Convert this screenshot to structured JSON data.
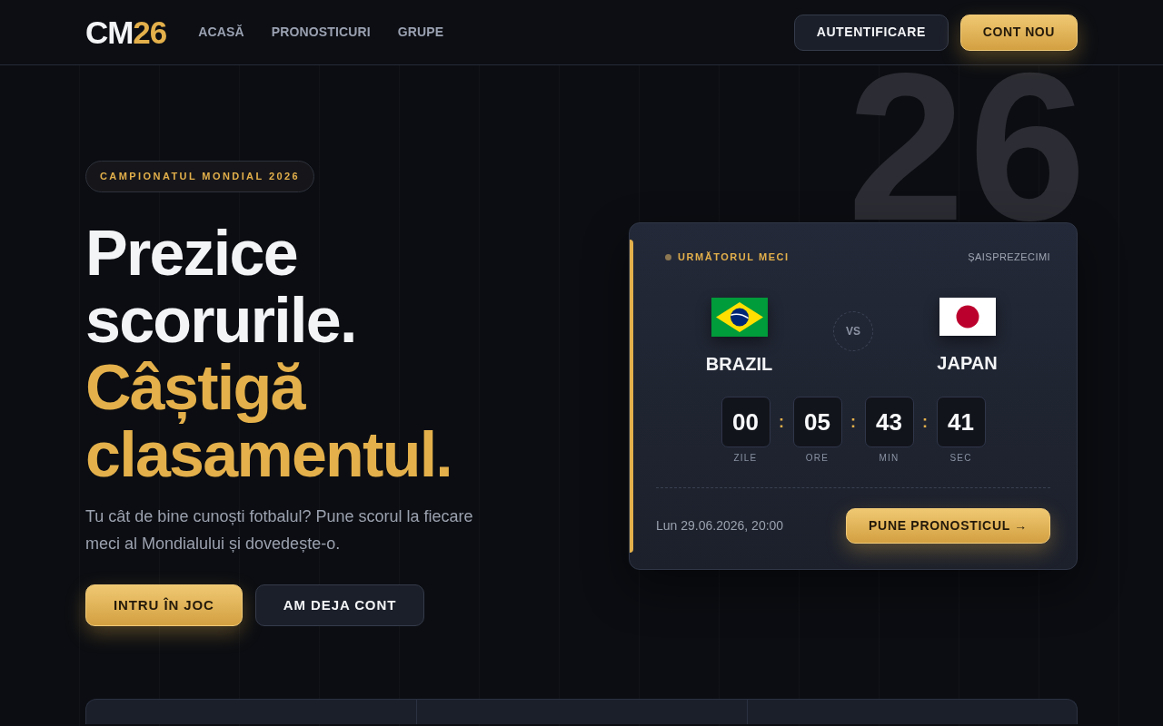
{
  "header": {
    "logo": {
      "text": "CM",
      "accent": "26"
    },
    "nav": [
      "ACASĂ",
      "PRONOSTICURI",
      "GRUPE"
    ],
    "buttons": [
      {
        "label": "AUTENTIFICARE",
        "kind": "secondary"
      },
      {
        "label": "CONT NOU",
        "kind": "primary"
      }
    ]
  },
  "hero": {
    "backdrop_text": "26",
    "badge": "CAMPIONATUL MONDIAL 2026",
    "headline": [
      {
        "text": "Prezice scorurile.",
        "kind": "plain"
      },
      {
        "text": "Câștigă clasamentul.",
        "kind": "accent"
      }
    ],
    "intro": "Tu cât de bine cunoști fotbalul? Pune scorul la fiecare meci al Mondialului și dovedește-o.",
    "buttons": [
      {
        "label": "INTRU ÎN JOC",
        "kind": "primary"
      },
      {
        "label": "AM DEJA CONT",
        "kind": "secondary"
      }
    ]
  },
  "match_card": {
    "label": "URMĂTORUL MECI",
    "stage": "ȘAISPREZECIMI",
    "teams": [
      {
        "name": "BRAZIL",
        "kind": "brazil"
      },
      {
        "name": "JAPAN",
        "kind": "japan"
      }
    ],
    "versus": "VS",
    "countdown": [
      {
        "value": "00",
        "unit": "ZILE"
      },
      {
        "value": "05",
        "unit": "ORE"
      },
      {
        "value": "43",
        "unit": "MIN"
      },
      {
        "value": "41",
        "unit": "SEC"
      }
    ],
    "separators": [
      ":",
      ":",
      ":"
    ],
    "kickoff": "Lun 29.06.2026, 20:00",
    "button": "PUNE PRONOSTICUL →"
  }
}
